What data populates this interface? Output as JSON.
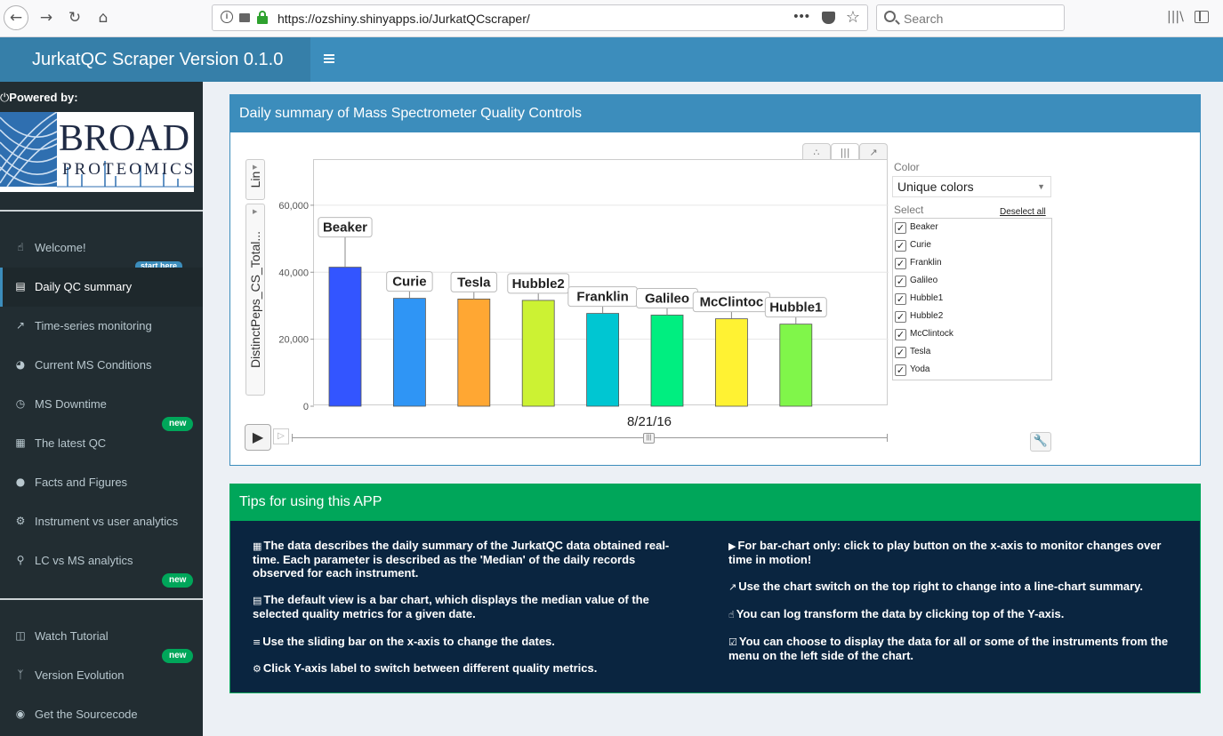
{
  "browser": {
    "url": "https://ozshiny.shinyapps.io/JurkatQCscraper/",
    "search_placeholder": "Search"
  },
  "header": {
    "title": "JurkatQC Scraper Version 0.1.0"
  },
  "sidebar": {
    "powered_by": "Powered by:",
    "logo_main": "BROAD",
    "logo_sub": "PROTEOMICS",
    "start_here": "start here",
    "items": [
      {
        "label": "Welcome!",
        "icon": "thumbs-up-icon"
      },
      {
        "label": "Daily QC summary",
        "icon": "bar-chart-icon"
      },
      {
        "label": "Time-series monitoring",
        "icon": "line-chart-icon"
      },
      {
        "label": "Current MS Conditions",
        "icon": "dashboard-icon"
      },
      {
        "label": "MS Downtime",
        "icon": "clock-icon",
        "badge": "new"
      },
      {
        "label": "The latest QC",
        "icon": "table-icon"
      },
      {
        "label": "Facts and Figures",
        "icon": "users-icon"
      },
      {
        "label": "Instrument vs user analytics",
        "icon": "cogs-icon"
      },
      {
        "label": "LC vs MS analytics",
        "icon": "flask-icon",
        "badge": "new"
      }
    ],
    "extra_items": [
      {
        "label": "Watch Tutorial",
        "icon": "film-icon",
        "badge": "new"
      },
      {
        "label": "Version Evolution",
        "icon": "branch-icon"
      },
      {
        "label": "Get the Sourcecode",
        "icon": "github-icon"
      }
    ]
  },
  "daily_box": {
    "title": "Daily summary of Mass Spectrometer Quality Controls",
    "lin_label": "Lin",
    "y_metric_label": "DistinctPeps_CS_Total...",
    "date": "8/21/16",
    "color_label": "Color",
    "color_value": "Unique colors",
    "select_label": "Select",
    "deselect_all": "Deselect all",
    "instruments": [
      "Beaker",
      "Curie",
      "Franklin",
      "Galileo",
      "Hubble1",
      "Hubble2",
      "McClintock",
      "Tesla",
      "Yoda"
    ]
  },
  "chart_data": {
    "type": "bar",
    "categories": [
      "Beaker",
      "Curie",
      "Tesla",
      "Hubble2",
      "Franklin",
      "Galileo",
      "McClintock",
      "Hubble1"
    ],
    "values": [
      41500,
      32200,
      32000,
      31600,
      27700,
      27200,
      26100,
      24500
    ],
    "colors": [
      "#3355ff",
      "#2f95f5",
      "#ffa733",
      "#ccf233",
      "#00c6d2",
      "#00ee80",
      "#fff233",
      "#80f64a"
    ],
    "display_labels": [
      "Beaker",
      "Curie",
      "Tesla",
      "Hubble2",
      "Franklin",
      "Galileo",
      "McClintoc",
      "Hubble1"
    ],
    "ylabel": "DistinctPeps_CS_Total...",
    "ylim": [
      0,
      73500
    ],
    "yticks": [
      0,
      20000,
      40000,
      60000
    ],
    "ytick_labels": [
      "0",
      "20,000",
      "40,000",
      "60,000"
    ],
    "grid": true
  },
  "tips_box": {
    "title": "Tips for using this APP",
    "left": [
      {
        "icon": "calendar-icon",
        "text": "The data describes the daily summary of the JurkatQC data obtained real-time. Each parameter is described as the 'Median' of the daily records observed for each instrument."
      },
      {
        "icon": "bar-chart-icon",
        "text": "The default view is a bar chart, which displays the median value of the selected quality metrics for a given date."
      },
      {
        "icon": "sliders-icon",
        "text": "Use the sliding bar on the x-axis to change the dates."
      },
      {
        "icon": "cogs-icon",
        "text": "Click Y-axis label to switch between different quality metrics."
      }
    ],
    "right": [
      {
        "icon": "play-icon",
        "text": "For bar-chart only: click to play button on the x-axis to monitor changes over time in motion!"
      },
      {
        "icon": "line-chart-icon",
        "text": "Use the chart switch on the top right to change into a line-chart summary."
      },
      {
        "icon": "thumbs-up-icon",
        "text": "You can log transform the data by clicking top of the Y-axis."
      },
      {
        "icon": "check-square-icon",
        "text": "You can choose to display the data for all or some of the instruments from the menu on the left side of the chart."
      }
    ]
  }
}
